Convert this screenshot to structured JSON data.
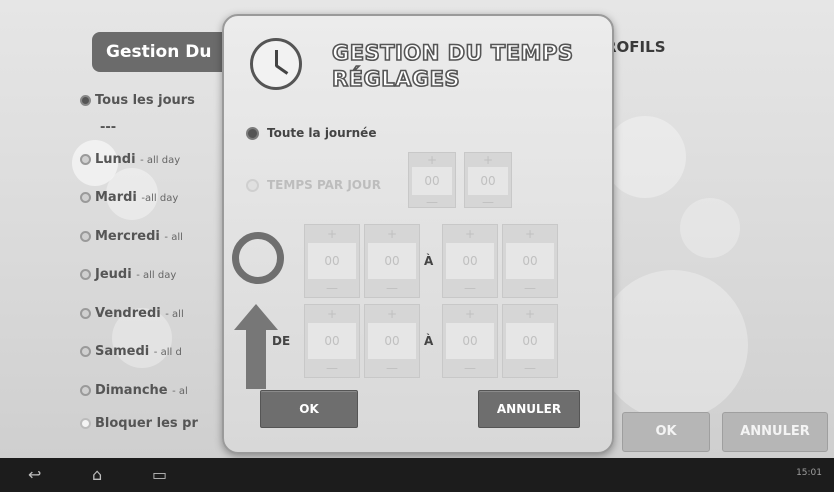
{
  "background": {
    "title": "Gestion Du",
    "profils_label": "ROFILS",
    "items": [
      {
        "label": "Tous les jours",
        "sub": "",
        "selected": true
      },
      {
        "label": "---",
        "sub": "",
        "selected": false
      },
      {
        "label": "Lundi",
        "sub": "- all day",
        "selected": false
      },
      {
        "label": "Mardi",
        "sub": "-all day",
        "selected": false
      },
      {
        "label": "Mercredi",
        "sub": "- all",
        "selected": false
      },
      {
        "label": "Jeudi",
        "sub": "- all day",
        "selected": false
      },
      {
        "label": "Vendredi",
        "sub": "- all",
        "selected": false
      },
      {
        "label": "Samedi",
        "sub": "- all d",
        "selected": false
      },
      {
        "label": "Dimanche",
        "sub": "- al",
        "selected": false
      },
      {
        "label": "Bloquer les pr",
        "sub": "",
        "selected": false
      }
    ],
    "ok_label": "OK",
    "cancel_label": "ANNULER"
  },
  "dialog": {
    "title_line1": "GESTION DU TEMPS",
    "title_line2": "RÉGLAGES",
    "option_all_day": "Toute la journée",
    "option_time_per_day": "TEMPS PAR JOUR",
    "time_per_day": {
      "hours": "00",
      "minutes": "00"
    },
    "range1": {
      "from_h": "00",
      "from_m": "00",
      "to_h": "00",
      "to_m": "00"
    },
    "range2": {
      "from_h": "00",
      "from_m": "00",
      "to_h": "00",
      "to_m": "00"
    },
    "label_de": "DE",
    "label_a": "À",
    "plus_symbol": "+",
    "minus_symbol": "—",
    "ok_label": "OK",
    "cancel_label": "ANNULER"
  },
  "navbar": {
    "time": "15:01",
    "icons": [
      "back-icon",
      "home-icon",
      "recent-apps-icon"
    ]
  }
}
